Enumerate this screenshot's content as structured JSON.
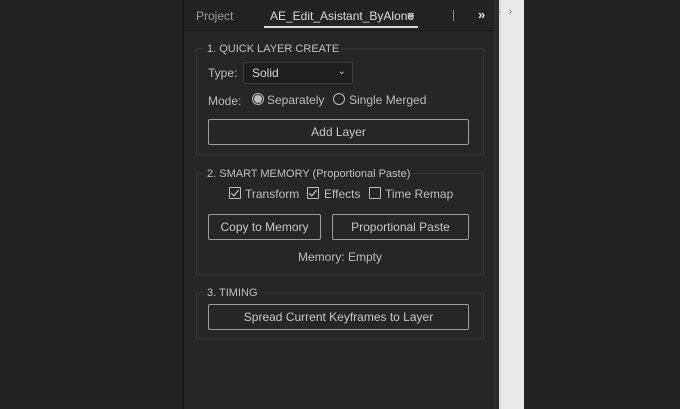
{
  "tabs": {
    "project": "Project",
    "active": "AE_Edit_Asistant_ByAlone",
    "menu_icon": "hamburger-icon",
    "overflow_icon": "double-chevron-right-icon"
  },
  "quick_layer": {
    "title": "1. QUICK LAYER CREATE",
    "type_label": "Type:",
    "type_value": "Solid",
    "mode_label": "Mode:",
    "mode_options": [
      {
        "label": "Separately",
        "selected": true
      },
      {
        "label": "Single Merged",
        "selected": false
      }
    ],
    "add_button": "Add Layer"
  },
  "smart_memory": {
    "title": "2. SMART MEMORY (Proportional Paste)",
    "checks": [
      {
        "label": "Transform",
        "checked": true
      },
      {
        "label": "Effects",
        "checked": true
      },
      {
        "label": "Time Remap",
        "checked": false
      }
    ],
    "copy_button": "Copy to Memory",
    "paste_button": "Proportional Paste",
    "status": "Memory: Empty"
  },
  "timing": {
    "title": "3. TIMING",
    "spread_button": "Spread Current Keyframes to Layer"
  },
  "colors": {
    "background": "#232323",
    "panel": "#262626",
    "text": "#bdbdbd",
    "button_border": "#9c9c9c"
  }
}
